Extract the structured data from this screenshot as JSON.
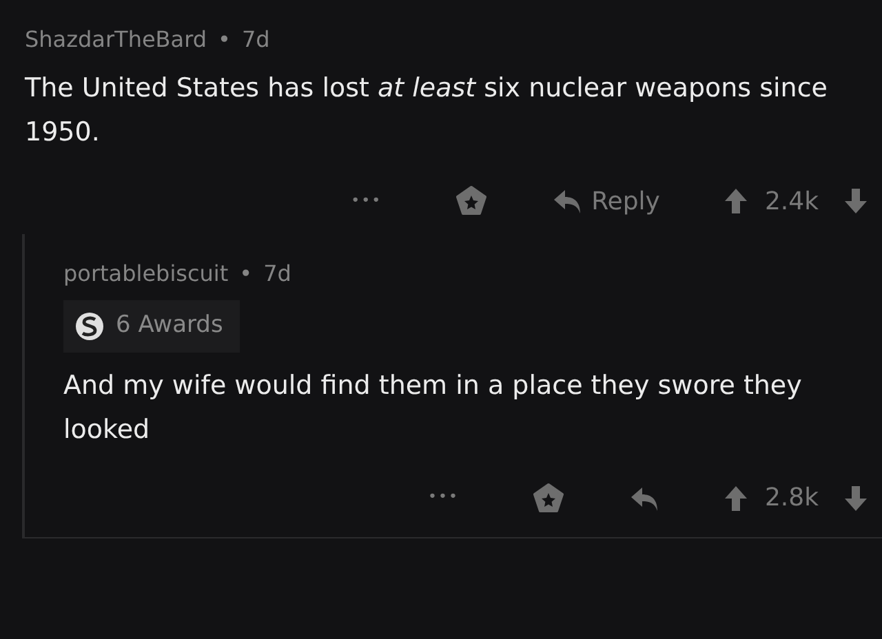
{
  "comments": [
    {
      "author": "ShazdarTheBard",
      "separator": "•",
      "age": "7d",
      "body": "The United States has lost *at least* six nuclear weapons since 1950.",
      "actions": {
        "more": "•••",
        "reply_label": "Reply",
        "score": "2.4k"
      }
    },
    {
      "author": "portablebiscuit",
      "separator": "•",
      "age": "7d",
      "awards": "6 Awards",
      "body": "And my wife would find them in a place they swore they looked",
      "actions": {
        "more": "•••",
        "score": "2.8k"
      }
    }
  ]
}
